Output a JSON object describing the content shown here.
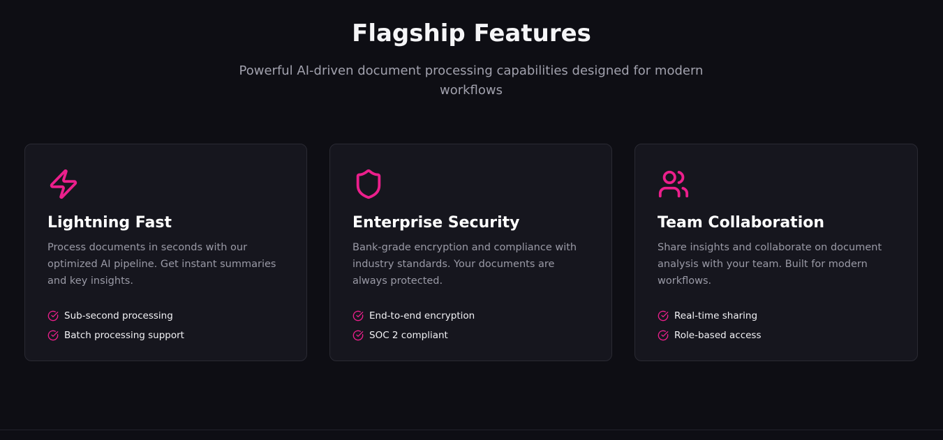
{
  "header": {
    "title": "Flagship Features",
    "subtitle": "Powerful AI-driven document processing capabilities designed for modern workflows"
  },
  "accent_color": "#ec1f8c",
  "cards": [
    {
      "icon": "lightning-icon",
      "title": "Lightning Fast",
      "description": "Process documents in seconds with our optimized AI pipeline. Get instant summaries and key insights.",
      "features": [
        "Sub-second processing",
        "Batch processing support"
      ]
    },
    {
      "icon": "shield-icon",
      "title": "Enterprise Security",
      "description": "Bank-grade encryption and compliance with industry standards. Your documents are always protected.",
      "features": [
        "End-to-end encryption",
        "SOC 2 compliant"
      ]
    },
    {
      "icon": "users-icon",
      "title": "Team Collaboration",
      "description": "Share insights and collaborate on document analysis with your team. Built for modern workflows.",
      "features": [
        "Real-time sharing",
        "Role-based access"
      ]
    }
  ]
}
